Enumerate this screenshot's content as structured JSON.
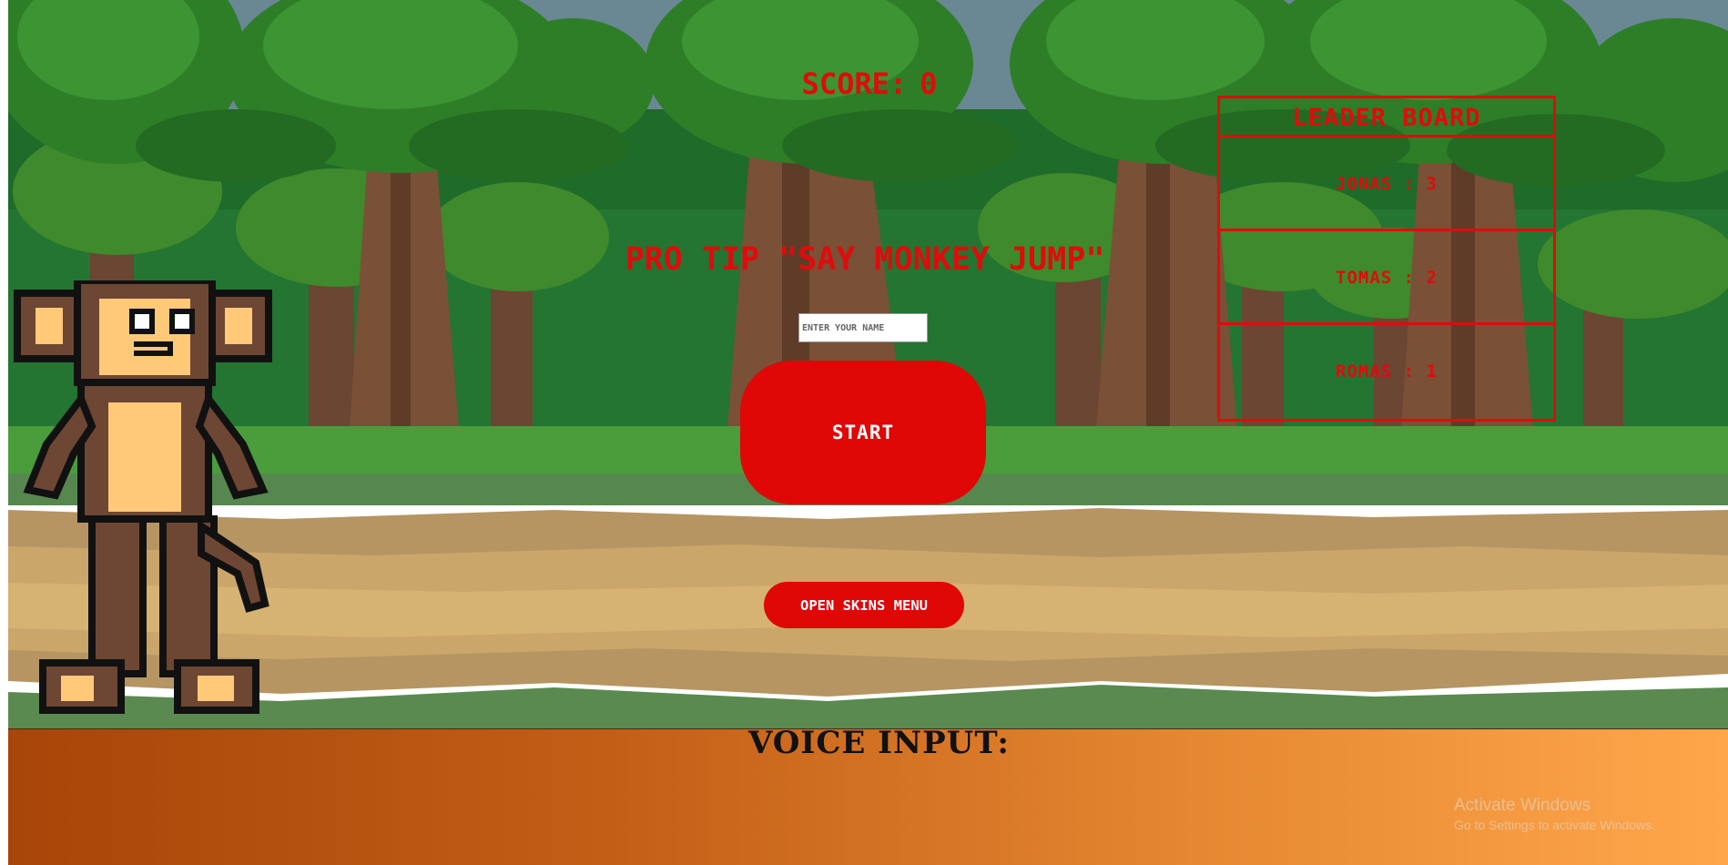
{
  "hud": {
    "score_label": "SCORE:",
    "score_value": "0",
    "pro_tip": "PRO TIP \"SAY MONKEY JUMP\""
  },
  "form": {
    "name_placeholder": "ENTER YOUR NAME",
    "start_label": "START",
    "skins_label": "OPEN SKINS MENU"
  },
  "leaderboard": {
    "title": "LEADER BOARD",
    "entries": [
      {
        "text": "JONAS : 3"
      },
      {
        "text": "TOMAS : 2"
      },
      {
        "text": "ROMAS : 1"
      }
    ]
  },
  "voice": {
    "label": "VOICE INPUT:"
  },
  "watermark": {
    "title": "Activate Windows",
    "subtitle": "Go to Settings to activate Windows."
  },
  "colors": {
    "accent_red": "#e00707",
    "sky": "#6a8794",
    "panel_gradient_start": "#a84508",
    "panel_gradient_end": "#ffa64b"
  },
  "icons": {
    "player": "monkey-character"
  }
}
